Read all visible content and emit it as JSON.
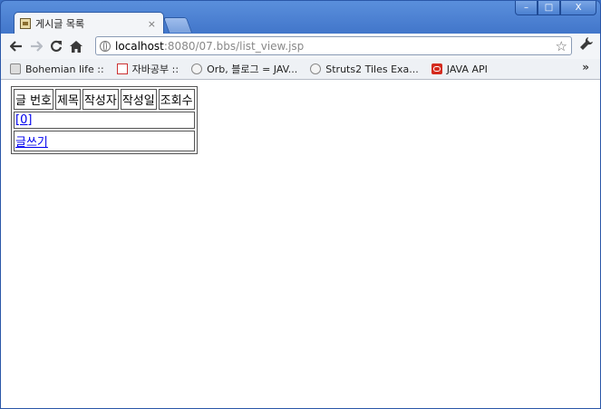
{
  "window": {
    "controls": {
      "minimize": "–",
      "maximize": "□",
      "close": "X"
    }
  },
  "tab": {
    "title": "게시글 목록",
    "close": "×"
  },
  "toolbar": {
    "url_host": "localhost",
    "url_rest": ":8080/07.bbs/list_view.jsp"
  },
  "bookmarks": {
    "items": [
      {
        "label": "Bohemian life ::",
        "icon": "printer-icon"
      },
      {
        "label": "자바공부 ::",
        "icon": "java-icon"
      },
      {
        "label": "Orb, 블로그 = JAV...",
        "icon": "globe-icon"
      },
      {
        "label": "Struts2 Tiles Exa...",
        "icon": "globe-icon"
      },
      {
        "label": "JAVA API",
        "icon": "oracle-icon"
      }
    ],
    "more": "»"
  },
  "board": {
    "headers": [
      "글 번호",
      "제목",
      "작성자",
      "작성일",
      "조회수"
    ],
    "page_link": "[0]",
    "write_link": "글쓰기"
  }
}
